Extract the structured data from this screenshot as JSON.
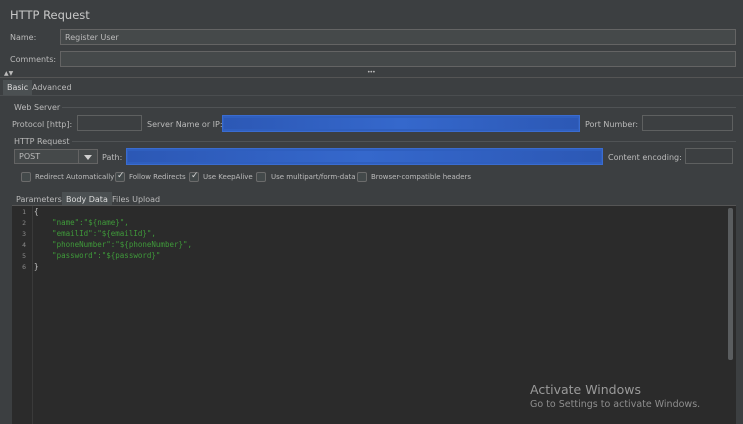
{
  "window": {
    "title": "HTTP Request"
  },
  "form": {
    "name_label": "Name:",
    "name_value": "Register User",
    "comments_label": "Comments:",
    "comments_value": ""
  },
  "splitter": {
    "dots": "•••",
    "arrows": "▲▼"
  },
  "top_tabs": [
    {
      "label": "Basic",
      "selected": true
    },
    {
      "label": "Advanced",
      "selected": false
    }
  ],
  "web_server": {
    "section_label": "Web Server",
    "protocol_label": "Protocol [http]:",
    "protocol_value": "",
    "server_label": "Server Name or IP:",
    "port_label": "Port Number:",
    "port_value": ""
  },
  "http_request": {
    "section_label": "HTTP Request",
    "method_value": "POST",
    "path_label": "Path:",
    "encoding_label": "Content encoding:",
    "encoding_value": ""
  },
  "options": [
    {
      "label": "Redirect Automatically",
      "checked": false
    },
    {
      "label": "Follow Redirects",
      "checked": true
    },
    {
      "label": "Use KeepAlive",
      "checked": true
    },
    {
      "label": "Use multipart/form-data",
      "checked": false
    },
    {
      "label": "Browser-compatible headers",
      "checked": false
    }
  ],
  "body_tabs": [
    {
      "label": "Parameters",
      "selected": false
    },
    {
      "label": "Body Data",
      "selected": true
    },
    {
      "label": "Files Upload",
      "selected": false
    }
  ],
  "editor": {
    "line_numbers": [
      "1",
      "2",
      "3",
      "4",
      "5",
      "6"
    ],
    "lines": [
      "{",
      "    \"name\":\"${name}\",",
      "    \"emailId\":\"${emailId}\",",
      "    \"phoneNumber\":\"${phoneNumber}\",",
      "    \"password\":\"${password}\"",
      "}"
    ]
  },
  "watermark": {
    "line1": "Activate Windows",
    "line2": "Go to Settings to activate Windows."
  },
  "colors": {
    "background": "#3c3f41",
    "editor_background": "#2b2b2b",
    "string": "#3f9a3a",
    "redaction": "#2f5fbf"
  }
}
